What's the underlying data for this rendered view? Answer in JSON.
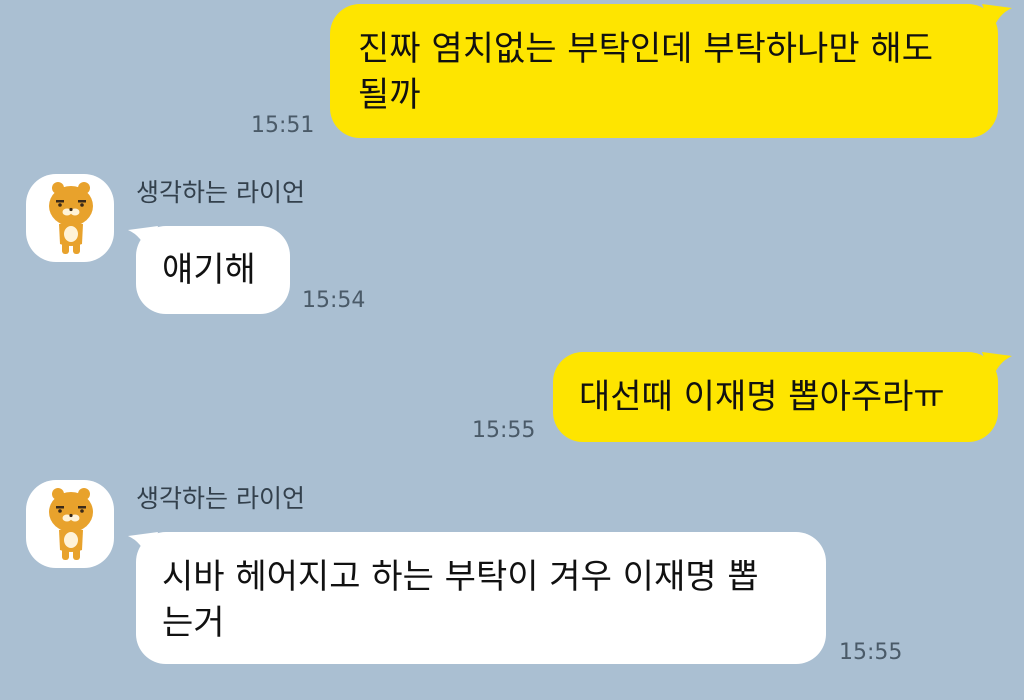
{
  "messages": [
    {
      "direction": "outgoing",
      "text": "진짜 염치없는 부탁인데 부탁하나만 해도\n될까",
      "time": "15:51"
    },
    {
      "direction": "incoming",
      "sender": "생각하는 라이언",
      "avatar_icon": "ryan-character-icon",
      "text": "얘기해",
      "time": "15:54"
    },
    {
      "direction": "outgoing",
      "text": "대선때 이재명 뽑아주라ㅠ",
      "time": "15:55"
    },
    {
      "direction": "incoming",
      "sender": "생각하는 라이언",
      "avatar_icon": "ryan-character-icon",
      "text": "시바 헤어지고 하는 부탁이 겨우 이재명 뽑\n는거",
      "time": "15:55"
    }
  ],
  "colors": {
    "background": "#AABFD2",
    "outgoing_bubble": "#FEE500",
    "incoming_bubble": "#FFFFFF"
  }
}
